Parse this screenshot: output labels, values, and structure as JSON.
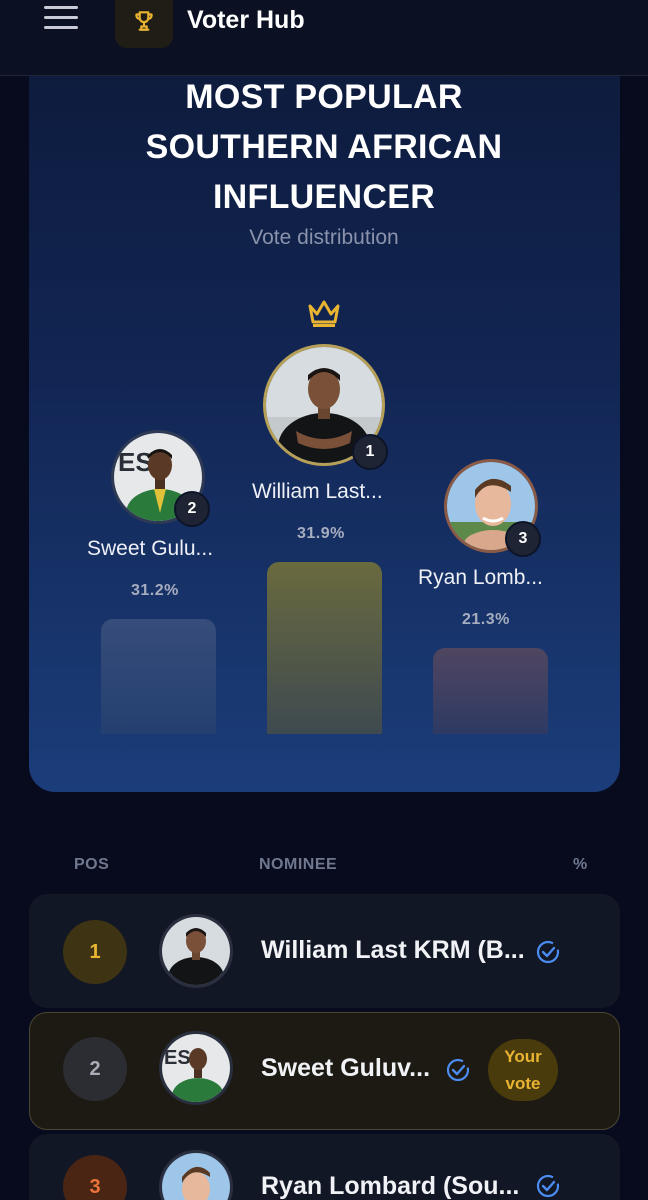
{
  "header": {
    "title": "Voter Hub",
    "menu_icon": "hamburger-menu-icon",
    "logo_icon": "trophy-icon",
    "accent": "#e8b431"
  },
  "podium": {
    "title_line1": "MOST POPULAR",
    "title_line2": "SOUTHERN AFRICAN",
    "title_line3": "INFLUENCER",
    "subtitle": "Vote distribution",
    "crown_icon": "crown-icon",
    "first": {
      "rank": "1",
      "name": "William Last...",
      "percent": "31.9%",
      "share": 31.9
    },
    "second": {
      "rank": "2",
      "name": "Sweet Gulu...",
      "percent": "31.2%",
      "share": 31.2
    },
    "third": {
      "rank": "3",
      "name": "Ryan Lomb...",
      "percent": "21.3%",
      "share": 21.3
    }
  },
  "table": {
    "headers": {
      "pos": "POS",
      "nominee": "NOMINEE",
      "percent": "%"
    },
    "rows": [
      {
        "pos": "1",
        "name": "William Last KRM (B...",
        "verified": true,
        "pos_color": "#e8b431"
      },
      {
        "pos": "2",
        "name": "Sweet Guluv...",
        "verified": true,
        "your_vote_line1": "Your",
        "your_vote_line2": "vote",
        "pos_color": "#9aa0ae"
      },
      {
        "pos": "3",
        "name": "Ryan Lombard (Sou...",
        "verified": true,
        "pos_color": "#e8743a"
      }
    ]
  }
}
